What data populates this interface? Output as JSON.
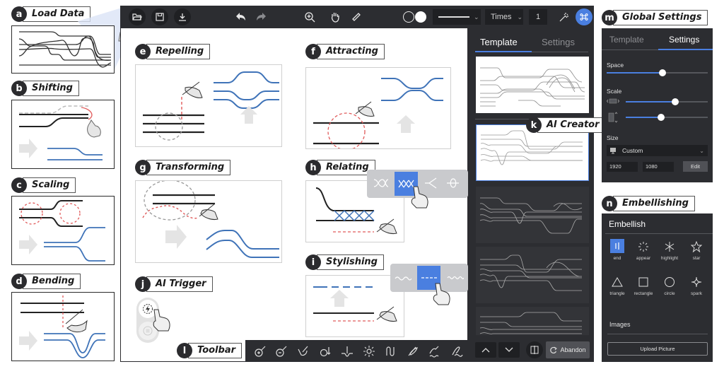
{
  "callouts": {
    "a": {
      "badge": "a",
      "label": "Load Data"
    },
    "b": {
      "badge": "b",
      "label": "Shifting"
    },
    "c": {
      "badge": "c",
      "label": "Scaling"
    },
    "d": {
      "badge": "d",
      "label": "Bending"
    },
    "e": {
      "badge": "e",
      "label": "Repelling"
    },
    "f": {
      "badge": "f",
      "label": "Attracting"
    },
    "g": {
      "badge": "g",
      "label": "Transforming"
    },
    "h": {
      "badge": "h",
      "label": "Relating"
    },
    "i": {
      "badge": "i",
      "label": "Stylishing"
    },
    "j": {
      "badge": "j",
      "label": "AI Trigger"
    },
    "k": {
      "badge": "k",
      "label": "AI Creator"
    },
    "l": {
      "badge": "l",
      "label": "Toolbar"
    },
    "m": {
      "badge": "m",
      "label": "Global Settings"
    },
    "n": {
      "badge": "n",
      "label": "Embellishing"
    }
  },
  "toolbar": {
    "file_buttons": [
      {
        "icon": "folder-open-icon",
        "label": "Open"
      },
      {
        "icon": "save-icon",
        "label": "Save"
      },
      {
        "icon": "download-icon",
        "label": "Export"
      }
    ],
    "history": [
      {
        "icon": "undo-icon"
      },
      {
        "icon": "redo-icon"
      }
    ],
    "tools": [
      {
        "icon": "zoom-in-icon"
      },
      {
        "icon": "hand-pan-icon"
      },
      {
        "icon": "ruler-icon"
      }
    ],
    "line_style_value": "solid",
    "font_value": "Times",
    "size_value": "1",
    "ai_wand_icon": "magic-wand-icon",
    "ai_active_icon": "command-icon",
    "colors": {
      "bar": "#2c2d31",
      "accent": "#4a7fe0"
    }
  },
  "ai_creator": {
    "tabs": [
      {
        "label": "Template",
        "active": true
      },
      {
        "label": "Settings",
        "active": false
      }
    ],
    "thumbnail_count": 5,
    "selected_thumbnail": 1,
    "nav": {
      "up": "up-icon",
      "down": "down-icon",
      "compare": "compare-icon"
    },
    "abandon_label": "Abandon"
  },
  "global_settings": {
    "tabs": [
      {
        "label": "Template",
        "active": false
      },
      {
        "label": "Settings",
        "active": true
      }
    ],
    "space": {
      "label": "Space",
      "value": 0.55
    },
    "scale": {
      "label": "Scale",
      "horizontal": 0.6,
      "vertical": 0.43
    },
    "size": {
      "label": "Size",
      "preset": "Custom",
      "width": "1920",
      "height": "1080",
      "edit_label": "Edit"
    }
  },
  "embellish": {
    "title": "Embellish",
    "items": [
      {
        "label": "end",
        "icon": "end-marker-icon",
        "selected": true
      },
      {
        "label": "appear",
        "icon": "appear-burst-icon",
        "selected": false
      },
      {
        "label": "highlight",
        "icon": "highlight-asterisk-icon",
        "selected": false
      },
      {
        "label": "star",
        "icon": "star-icon",
        "selected": false
      },
      {
        "label": "triangle",
        "icon": "triangle-icon",
        "selected": false
      },
      {
        "label": "rectangle",
        "icon": "rectangle-icon",
        "selected": false
      },
      {
        "label": "circle",
        "icon": "circle-icon",
        "selected": false
      },
      {
        "label": "spark",
        "icon": "spark-icon",
        "selected": false
      }
    ],
    "images_label": "Images",
    "upload_label": "Upload Picture"
  },
  "draw_toolbar": {
    "tools": [
      {
        "icon": "repel-pen-icon"
      },
      {
        "icon": "attract-pen-icon"
      },
      {
        "icon": "transform-pen-icon"
      },
      {
        "icon": "scale-pen-icon"
      },
      {
        "icon": "bend-pen-icon"
      },
      {
        "icon": "appear-pen-icon"
      },
      {
        "icon": "relate-pen-icon"
      },
      {
        "icon": "style-pen-icon"
      },
      {
        "icon": "wave-pen-icon"
      },
      {
        "icon": "freehand-pen-icon"
      }
    ]
  },
  "relating_popup": {
    "options": [
      "twist-loose",
      "twist-tight",
      "merge",
      "knot"
    ],
    "selected": 1
  },
  "stylishing_popup": {
    "options": [
      "wavy",
      "dashed",
      "zigzag"
    ],
    "selected": 1
  }
}
